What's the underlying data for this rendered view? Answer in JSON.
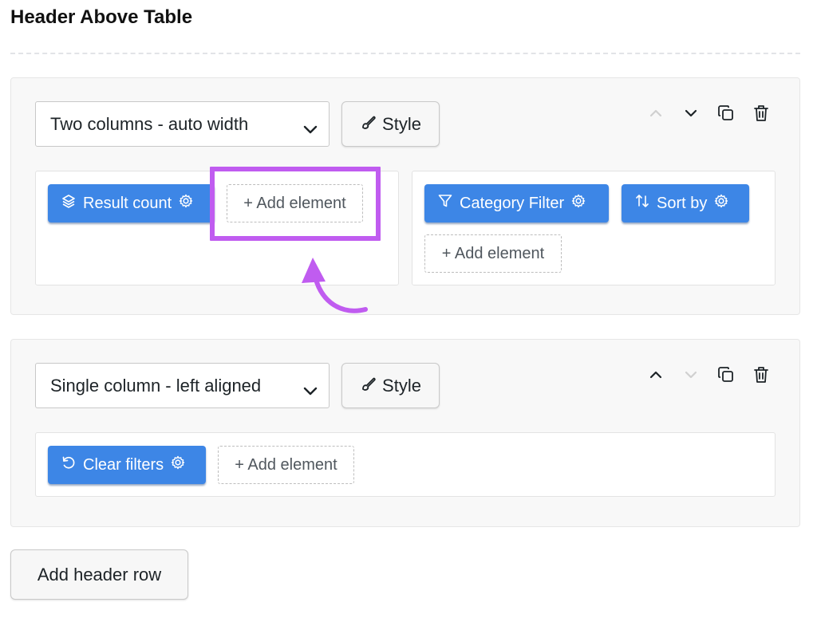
{
  "section": {
    "title": "Header Above Table"
  },
  "rows": [
    {
      "layout": "Two columns - auto width",
      "style_label": "Style",
      "columns": [
        {
          "elements": [
            {
              "label": "Result count",
              "icon": "layers-icon"
            }
          ],
          "add_label": "+ Add element"
        },
        {
          "elements": [
            {
              "label": "Category Filter",
              "icon": "funnel-icon"
            },
            {
              "label": "Sort by",
              "icon": "sort-arrows-icon"
            }
          ],
          "add_label": "+ Add element"
        }
      ],
      "move_up_enabled": false,
      "move_down_enabled": true
    },
    {
      "layout": "Single column - left aligned",
      "style_label": "Style",
      "columns": [
        {
          "elements": [
            {
              "label": "Clear filters",
              "icon": "reset-icon"
            }
          ],
          "add_label": "+ Add element"
        }
      ],
      "move_up_enabled": true,
      "move_down_enabled": false
    }
  ],
  "add_row_label": "Add header row",
  "colors": {
    "element_button": "#3d86e6",
    "highlight": "#c05cf0",
    "panel_bg": "#f8f8f8"
  }
}
